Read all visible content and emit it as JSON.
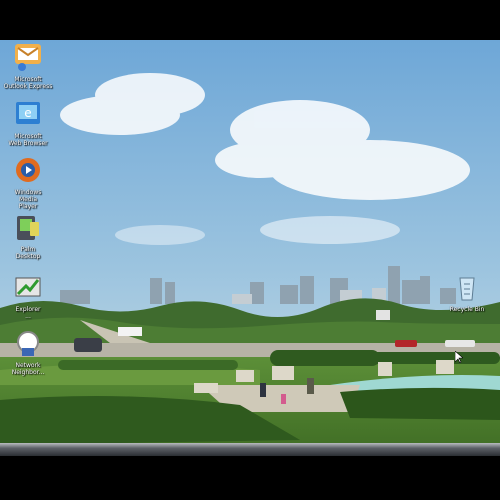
{
  "desktop": {
    "icons": [
      {
        "name": "Microsoft Outlook Express",
        "label": "Microsoft\nOutlook Express",
        "icon": "outlook-express-icon"
      },
      {
        "name": "Microsoft Web Browser",
        "label": "Microsoft\nWeb Browser",
        "icon": "web-browser-icon"
      },
      {
        "name": "Windows Media Player",
        "label": "Windows\nMedia\nPlayer",
        "icon": "media-player-icon"
      },
      {
        "name": "Palm Desktop",
        "label": "Palm\nDesktop",
        "icon": "palm-desktop-icon"
      },
      {
        "name": "Explorer",
        "label": "Explorer\n...",
        "icon": "explorer-icon"
      },
      {
        "name": "Network Neighborhood",
        "label": "Network\nNeighbor...",
        "icon": "network-icon"
      },
      {
        "name": "Recycle Bin",
        "label": "Recycle Bin",
        "icon": "recycle-bin-icon"
      }
    ]
  },
  "wallpaper": {
    "subject": "city-park-skyline"
  },
  "colors": {
    "sky_top": "#6fa8d6",
    "sky_bottom": "#c6dbe8",
    "grass": "#4a7d2e",
    "water": "#9fd8d2"
  }
}
